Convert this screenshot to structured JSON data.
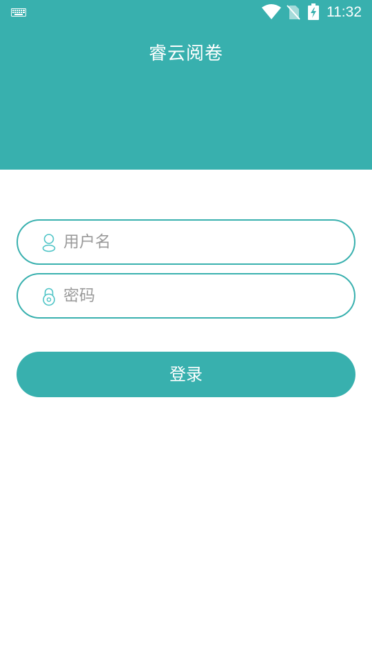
{
  "status_bar": {
    "time": "11:32",
    "icons": [
      "keyboard-icon",
      "wifi-icon",
      "no-sim-icon",
      "battery-charging-icon"
    ]
  },
  "header": {
    "title": "睿云阅卷"
  },
  "login_form": {
    "username": {
      "placeholder": "用户名",
      "value": "",
      "icon": "user-icon"
    },
    "password": {
      "placeholder": "密码",
      "value": "",
      "icon": "lock-icon"
    },
    "submit_label": "登录"
  },
  "colors": {
    "accent": "#38b0ae",
    "background": "#ffffff",
    "placeholder": "#9a9a9a"
  }
}
